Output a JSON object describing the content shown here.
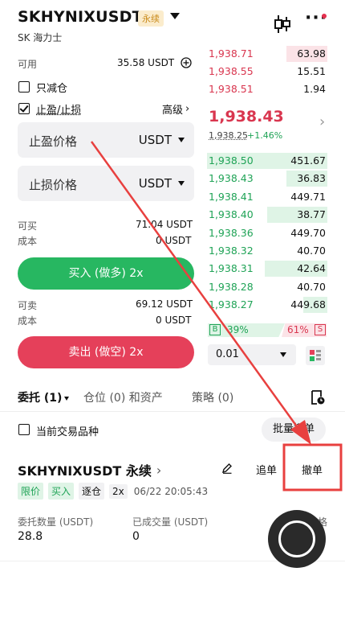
{
  "header": {
    "title": "SKHYNIXUSDT",
    "badge": "永续",
    "subtitle": "SK 海力士"
  },
  "form": {
    "available_label": "可用",
    "available_value": "35.58 USDT",
    "reduce_only_label": "只减仓",
    "tpsl_label": "止盈/止损",
    "advanced_label": "高级",
    "advanced_chevron": "›",
    "tp_placeholder": "止盈价格",
    "tp_unit": "USDT",
    "sl_placeholder": "止损价格",
    "sl_unit": "USDT",
    "can_buy_label": "可买",
    "can_buy_value": "71.04 USDT",
    "cost_label": "成本",
    "buy_cost_value": "0 USDT",
    "buy_button": "买入 (做多) 2x",
    "can_sell_label": "可卖",
    "can_sell_value": "69.12 USDT",
    "sell_cost_value": "0 USDT",
    "sell_button": "卖出 (做空) 2x"
  },
  "orderbook": {
    "asks": [
      {
        "price": "1,938.71",
        "qty": "63.98",
        "depth": 0.34
      },
      {
        "price": "1,938.55",
        "qty": "15.51",
        "depth": 0.0
      },
      {
        "price": "1,938.51",
        "qty": "1.94",
        "depth": 0.0
      }
    ],
    "last_price": "1,938.43",
    "mark_price": "1,938.25",
    "change": "+1.46%",
    "chevron": "›",
    "bids": [
      {
        "price": "1,938.50",
        "qty": "451.67",
        "depth": 1.0
      },
      {
        "price": "1,938.43",
        "qty": "36.83",
        "depth": 0.34
      },
      {
        "price": "1,938.41",
        "qty": "449.71",
        "depth": 0.0
      },
      {
        "price": "1,938.40",
        "qty": "38.77",
        "depth": 0.5
      },
      {
        "price": "1,938.36",
        "qty": "449.70",
        "depth": 0.0
      },
      {
        "price": "1,938.32",
        "qty": "40.70",
        "depth": 0.0
      },
      {
        "price": "1,938.31",
        "qty": "42.64",
        "depth": 0.52
      },
      {
        "price": "1,938.28",
        "qty": "40.70",
        "depth": 0.0
      },
      {
        "price": "1,938.27",
        "qty": "449.68",
        "depth": 0.2
      }
    ],
    "buy_ratio_letter": "B",
    "buy_ratio": "39%",
    "sell_ratio": "61%",
    "sell_ratio_letter": "S",
    "precision": "0.01"
  },
  "tabs": {
    "orders": "委托 (1)",
    "positions": "仓位 (0) 和资产",
    "strategies": "策略 (0)"
  },
  "filter": {
    "current_symbol_label": "当前交易品种",
    "batch_button": "批量撤单"
  },
  "order": {
    "symbol": "SKHYNIXUSDT 永续",
    "symbol_chevron": "›",
    "chase_button": "追单",
    "cancel_button": "撤单",
    "tag_type": "限价",
    "tag_side": "买入",
    "tag_margin": "逐仓",
    "tag_leverage": "2x",
    "time": "06/22 20:05:43",
    "qty_label": "委托数量 (USDT)",
    "qty_value": "28.8",
    "filled_label": "已成交量 (USDT)",
    "filled_value": "0",
    "cut_label": "格"
  },
  "colors": {
    "ask": "#d9364f",
    "bid": "#1fa356",
    "buy": "#27b761",
    "sell": "#e5405a",
    "annotation": "#e8403f"
  }
}
